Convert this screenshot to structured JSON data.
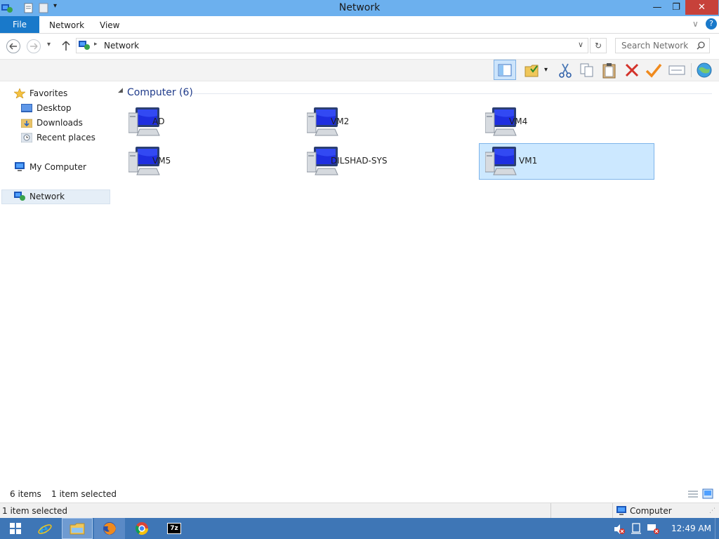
{
  "window": {
    "title": "Network",
    "buttons": {
      "minimize": "—",
      "restore": "❐",
      "close": "✕"
    }
  },
  "ribbon": {
    "tabs": [
      {
        "label": "File"
      },
      {
        "label": "Network"
      },
      {
        "label": "View"
      }
    ]
  },
  "address": {
    "path": "Network",
    "search_placeholder": "Search Network"
  },
  "toolbar": {
    "icons": [
      "preview-pane-icon",
      "properties-icon",
      "cut-icon",
      "copy-icon",
      "paste-icon",
      "delete-icon",
      "check-icon",
      "rename-icon",
      "network-globe-icon"
    ]
  },
  "nav": {
    "favorites": "Favorites",
    "desktop": "Desktop",
    "downloads": "Downloads",
    "recent_places": "Recent places",
    "my_computer": "My Computer",
    "network": "Network"
  },
  "content": {
    "group_title": "Computer (6)",
    "items": [
      {
        "label": "AD",
        "selected": false
      },
      {
        "label": "VM2",
        "selected": false
      },
      {
        "label": "VM4",
        "selected": false
      },
      {
        "label": "VM5",
        "selected": false
      },
      {
        "label": "DILSHAD-SYS",
        "selected": false
      },
      {
        "label": "VM1",
        "selected": true
      }
    ]
  },
  "status": {
    "item_count": "6 items",
    "selected": "1 item selected"
  },
  "details": {
    "selected": "1 item selected",
    "location": "Computer"
  },
  "taskbar": {
    "clock": "12:49 AM",
    "apps": [
      "windows-start-icon",
      "internet-explorer-icon",
      "file-explorer-icon",
      "firefox-icon",
      "chrome-icon",
      "7zip-icon"
    ]
  },
  "colors": {
    "titlebar": "#6cb0ee",
    "file_tab": "#1979ca",
    "selection_fill": "#cce8ff",
    "selection_border": "#7eb4ea",
    "taskbar": "#3e76b6",
    "group_title": "#1e3a8a"
  }
}
